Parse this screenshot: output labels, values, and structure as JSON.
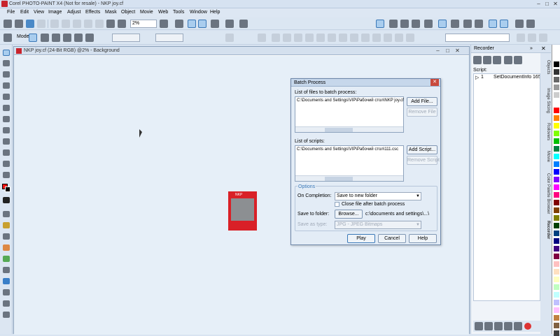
{
  "app": {
    "title": "Corel PHOTO-PAINT X4 (Not for resale) - NKP joy.cf",
    "min": "–",
    "max": "□",
    "close": "✕"
  },
  "menu": [
    "File",
    "Edit",
    "View",
    "Image",
    "Adjust",
    "Effects",
    "Mask",
    "Object",
    "Movie",
    "Web",
    "Tools",
    "Window",
    "Help"
  ],
  "toolbar": {
    "zoom": "2%",
    "mode_label": "Mode"
  },
  "document": {
    "title": "NKP joy.cf (24-Bit RGB) @2% - Background",
    "thumb_text": "NKP"
  },
  "dialog": {
    "title": "Batch Process",
    "files_label": "List of files to batch process:",
    "files": [
      "C:\\Documents and Settings\\VIP\\Рабочий стол\\NKP joy.cf"
    ],
    "add_file": "Add File...",
    "remove_file": "Remove File",
    "scripts_label": "List of scripts:",
    "scripts": [
      "C:\\Documents and Settings\\VIP\\Рабочий стол\\111.csc"
    ],
    "add_script": "Add Script...",
    "remove_script": "Remove Script",
    "options_label": "Options",
    "on_completion_label": "On Completion:",
    "on_completion_value": "Save to new folder",
    "close_file_label": "Close file after batch process",
    "save_folder_label": "Save to folder:",
    "browse": "Browse...",
    "folder_path": "c:\\documents and settings\\...\\",
    "save_type_label": "Save as type:",
    "save_type_value": "JPG - JPEG Bitmaps",
    "play": "Play",
    "cancel": "Cancel",
    "help": "Help"
  },
  "recorder": {
    "title": "Recorder",
    "script_label": "Script:",
    "step_num": "1",
    "step_text": "SetDocumentInfo 1654, 2"
  },
  "tabs": [
    "Objects",
    "Image Slicing",
    "Rollovers",
    "Movie",
    "Color Palette Browser",
    "Recorder"
  ],
  "colors": {
    "accent": "#4a89c7",
    "brand": "#c8232c"
  },
  "palette": [
    "#000000",
    "#333333",
    "#666666",
    "#999999",
    "#cccccc",
    "#ffffff",
    "#ff0000",
    "#ff8000",
    "#ffff00",
    "#80ff00",
    "#00c000",
    "#008040",
    "#00ffff",
    "#0080ff",
    "#0000ff",
    "#8000ff",
    "#ff00ff",
    "#ff0080",
    "#800000",
    "#804000",
    "#808000",
    "#004000",
    "#004080",
    "#000080",
    "#400080",
    "#800040",
    "#ffc0c0",
    "#ffe0c0",
    "#ffffc0",
    "#c0ffc0",
    "#c0ffff",
    "#c0c0ff",
    "#ffc0ff",
    "#c08040",
    "#806040",
    "#404040"
  ]
}
